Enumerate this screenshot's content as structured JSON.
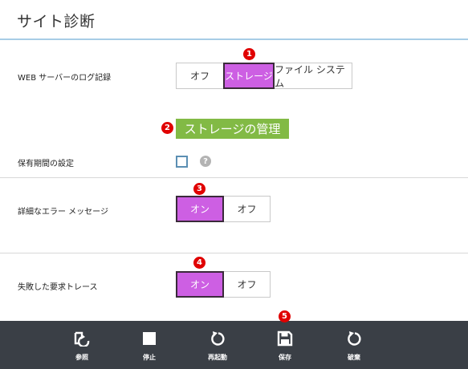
{
  "title": "サイト診断",
  "web_log": {
    "label": "WEB サーバーのログ記録",
    "options": [
      "オフ",
      "ストレージ",
      "ファイル システム"
    ],
    "selected": "ストレージ"
  },
  "storage_section": {
    "label": "ストレージの管理"
  },
  "retention": {
    "label": "保有期間の設定",
    "checked": false,
    "help": "?"
  },
  "detailed_errors": {
    "label": "詳細なエラー メッセージ",
    "options": [
      "オン",
      "オフ"
    ],
    "selected": "オン"
  },
  "failed_trace": {
    "label": "失敗した要求トレース",
    "options": [
      "オン",
      "オフ"
    ],
    "selected": "オン"
  },
  "markers": [
    "1",
    "2",
    "3",
    "4",
    "5"
  ],
  "toolbar": {
    "browse": {
      "label": "参照",
      "icon": "browse-icon"
    },
    "stop": {
      "label": "停止",
      "icon": "stop-icon"
    },
    "restart": {
      "label": "再起動",
      "icon": "restart-icon"
    },
    "save": {
      "label": "保存",
      "icon": "save-icon"
    },
    "discard": {
      "label": "破棄",
      "icon": "discard-icon"
    }
  },
  "colors": {
    "accent_on": "#cd5fe3",
    "section_banner": "#82ba45",
    "marker": "#e00000",
    "toolbar_bg": "#3a3f46",
    "title_rule": "#a7cde6"
  }
}
